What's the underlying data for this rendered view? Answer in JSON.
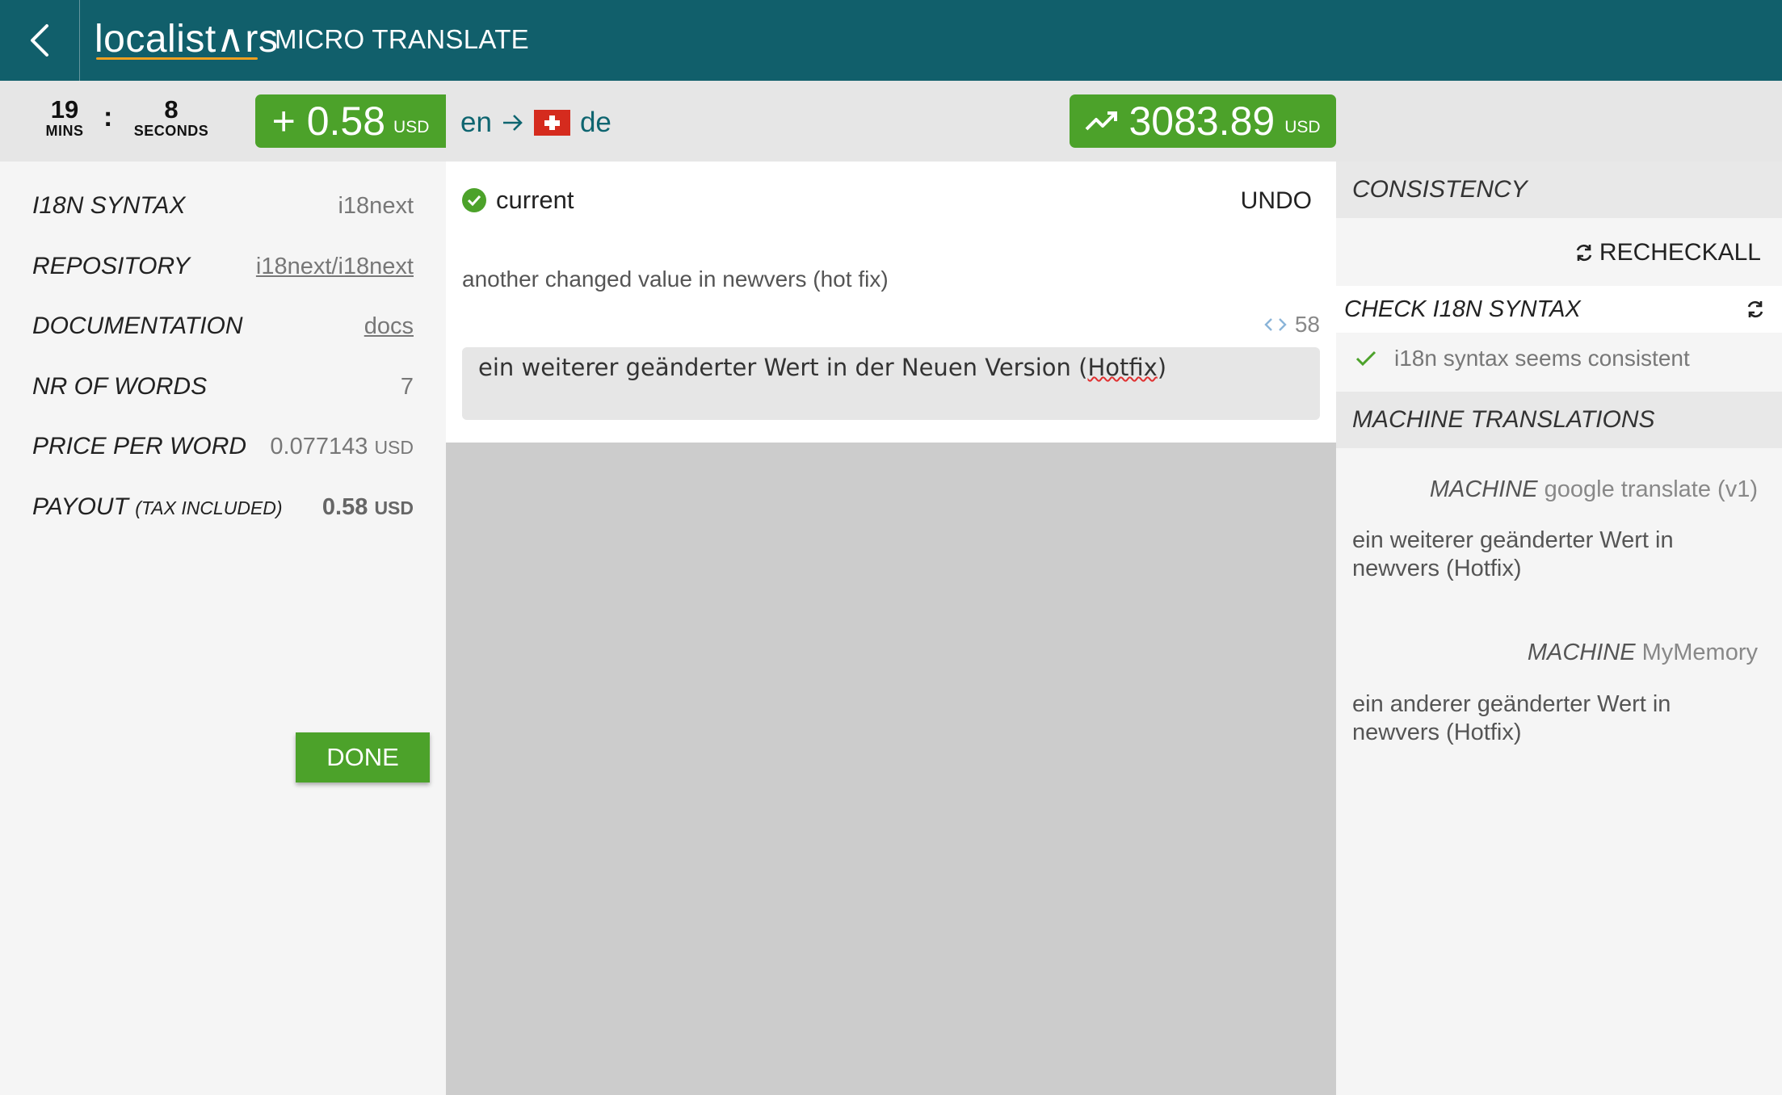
{
  "header": {
    "logo_text": "localist∧rs",
    "app_title": "MICRO TRANSLATE",
    "back_icon": "chevron-left-icon"
  },
  "toolbar": {
    "timer": {
      "minutes": "19",
      "minutes_label": "MINS",
      "separator": ":",
      "seconds": "8",
      "seconds_label": "SECONDS"
    },
    "reward": {
      "value": "+ 0.58",
      "currency": "USD"
    },
    "language": {
      "source": "en",
      "target": "de",
      "target_flag": "switzerland-flag"
    },
    "balance": {
      "value": "3083.89",
      "currency": "USD",
      "icon": "trending-up-icon"
    }
  },
  "info": {
    "syntax": {
      "label": "I18N SYNTAX",
      "value": "i18next"
    },
    "repository": {
      "label": "REPOSITORY",
      "value": "i18next/i18next"
    },
    "documentation": {
      "label": "DOCUMENTATION",
      "value": "docs"
    },
    "words": {
      "label": "NR OF WORDS",
      "value": "7"
    },
    "price": {
      "label": "PRICE PER WORD",
      "value": "0.077143",
      "currency": "USD"
    },
    "payout": {
      "label": "PAYOUT",
      "label_note": "(TAX INCLUDED)",
      "value": "0.58",
      "currency": "USD"
    },
    "done_label": "DONE"
  },
  "editor": {
    "status": "current",
    "undo_label": "UNDO",
    "source_text": "another changed value in newvers (hot fix)",
    "char_count": "58",
    "translation_before": "ein weiterer geänderter Wert in der Neuen Version (",
    "translation_misspelled": "Hotfix",
    "translation_after": ")"
  },
  "consistency": {
    "header": "CONSISTENCY",
    "recheck_label": "RECHECKALL",
    "check_label": "CHECK I18N SYNTAX",
    "check_result": "i18n syntax seems consistent"
  },
  "machine": {
    "header": "MACHINE TRANSLATIONS",
    "items": [
      {
        "prefix": "MACHINE",
        "engine": "google translate (v1)",
        "text": "ein weiterer geänderter Wert in newvers (Hotfix)"
      },
      {
        "prefix": "MACHINE",
        "engine": "MyMemory",
        "text": "ein anderer geänderter Wert in newvers (Hotfix)"
      }
    ]
  },
  "colors": {
    "header_bg": "#115f6b",
    "accent_green": "#4ca22a",
    "logo_underline": "#f0a020"
  }
}
